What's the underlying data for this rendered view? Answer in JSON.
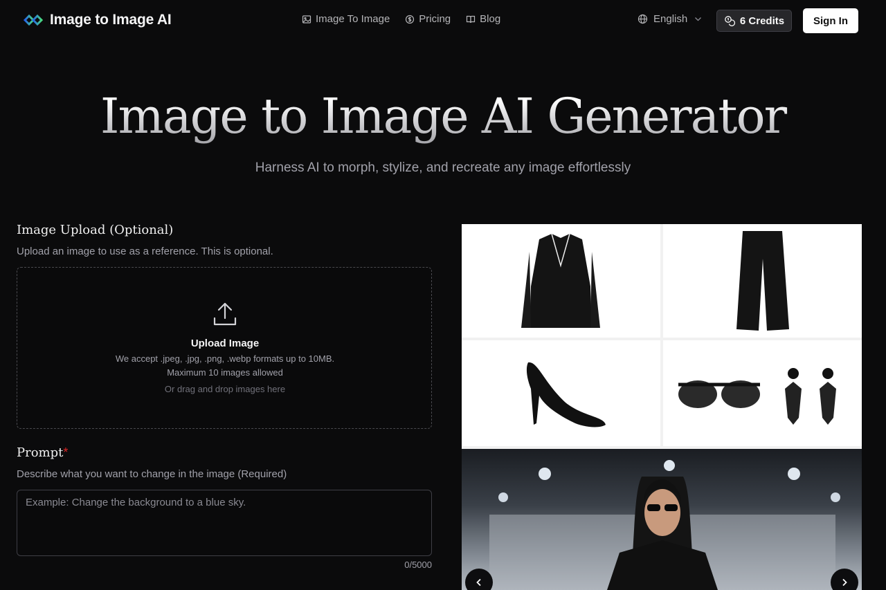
{
  "brand": {
    "name": "Image to Image AI"
  },
  "nav": {
    "links": [
      {
        "label": "Image To Image",
        "icon": "image-icon"
      },
      {
        "label": "Pricing",
        "icon": "coin-icon"
      },
      {
        "label": "Blog",
        "icon": "book-icon"
      }
    ],
    "language": "English",
    "credits": "6 Credits",
    "signin": "Sign In"
  },
  "hero": {
    "title": "Image to Image AI Generator",
    "subtitle": "Harness AI to morph, stylize, and recreate any image effortlessly"
  },
  "upload": {
    "title": "Image Upload (Optional)",
    "description": "Upload an image to use as a reference. This is optional.",
    "box_title": "Upload Image",
    "formats": "We accept .jpeg, .jpg, .png, .webp formats up to 10MB.",
    "max": "Maximum 10 images allowed",
    "drag": "Or drag and drop images here"
  },
  "prompt": {
    "title": "Prompt",
    "required_mark": "*",
    "description": "Describe what you want to change in the image (Required)",
    "placeholder": "Example: Change the background to a blue sky.",
    "counter": "0/5000"
  },
  "colors": {
    "background": "#0b0b0c",
    "accent_required": "#dc2626",
    "brand_gradient_start": "#2563eb",
    "brand_gradient_end": "#22c55e"
  }
}
